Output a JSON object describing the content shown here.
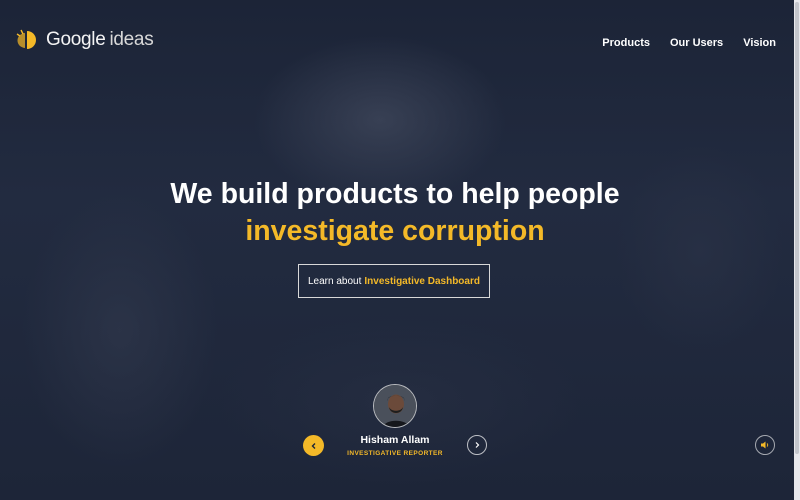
{
  "header": {
    "logo_brand": "Google",
    "logo_product": "ideas",
    "nav": [
      {
        "label": "Products"
      },
      {
        "label": "Our Users"
      },
      {
        "label": "Vision"
      }
    ]
  },
  "hero": {
    "headline_line1": "We build products to help people",
    "headline_line2": "investigate corruption",
    "cta_prefix": "Learn about",
    "cta_link": "Investigative Dashboard"
  },
  "testimonial": {
    "name": "Hisham Allam",
    "role": "INVESTIGATIVE REPORTER",
    "prev_icon": "chevron-left-icon",
    "next_icon": "chevron-right-icon"
  },
  "controls": {
    "sound_icon": "speaker-icon"
  },
  "colors": {
    "accent": "#f4b928",
    "background": "#1b2336"
  }
}
